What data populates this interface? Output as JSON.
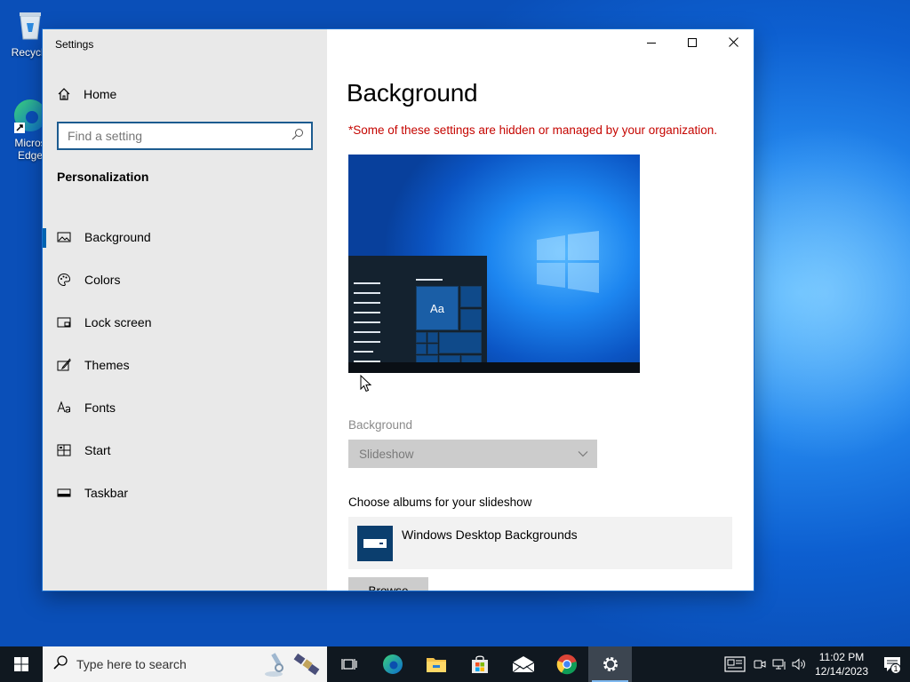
{
  "desktop": {
    "icons": [
      {
        "label": "Recycle",
        "icon": "recycle-bin-icon"
      },
      {
        "label": "Micros Edge",
        "icon": "edge-icon"
      }
    ]
  },
  "window": {
    "title": "Settings",
    "controls": [
      "minimize-icon",
      "maximize-icon",
      "close-icon"
    ]
  },
  "sidebar": {
    "home_label": "Home",
    "search_placeholder": "Find a setting",
    "section_title": "Personalization",
    "items": [
      {
        "label": "Background",
        "icon": "picture-icon",
        "active": true
      },
      {
        "label": "Colors",
        "icon": "palette-icon"
      },
      {
        "label": "Lock screen",
        "icon": "lock-screen-icon"
      },
      {
        "label": "Themes",
        "icon": "brush-icon"
      },
      {
        "label": "Fonts",
        "icon": "fonts-icon"
      },
      {
        "label": "Start",
        "icon": "start-icon"
      },
      {
        "label": "Taskbar",
        "icon": "taskbar-icon"
      }
    ]
  },
  "main": {
    "title": "Background",
    "org_notice": "*Some of these settings are hidden or managed by your organization.",
    "preview_sample_text": "Aa",
    "background_label": "Background",
    "background_value": "Slideshow",
    "albums_label": "Choose albums for your slideshow",
    "album_name": "Windows Desktop Backgrounds",
    "browse_label": "Browse"
  },
  "taskbar": {
    "search_placeholder": "Type here to search",
    "apps": [
      "task-view-icon",
      "edge-icon",
      "file-explorer-icon",
      "store-icon",
      "mail-icon",
      "chrome-icon",
      "settings-icon"
    ],
    "time": "11:02 PM",
    "date": "12/14/2023",
    "notification_count": "1"
  },
  "colors": {
    "accent": "#0063b1",
    "org_notice": "#c50500",
    "taskbar": "#101820"
  }
}
